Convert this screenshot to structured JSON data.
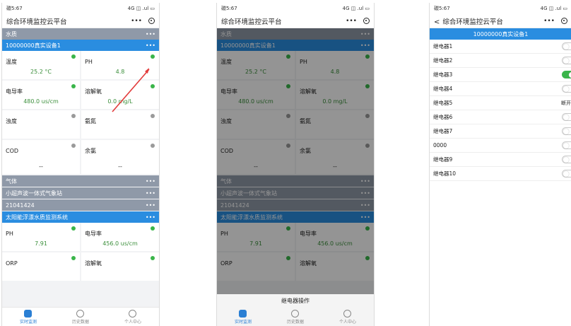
{
  "status_left": "碳5:67",
  "status_right": "4G ◫ .ul ▭",
  "app_title": "综合环境监控云平台",
  "more_label": "•••",
  "colors": {
    "blue": "#2a8de0",
    "gray_header": "#8f99a8",
    "green": "#3ab54a",
    "gray_dot": "#9a9a9a"
  },
  "panel1": {
    "sec_water": "水质",
    "device1": "10000000真实设备1",
    "cards": [
      {
        "label": "温度",
        "value": "25.2 °C",
        "dot": "green"
      },
      {
        "label": "PH",
        "value": "4.8",
        "dot": "green"
      },
      {
        "label": "电导率",
        "value": "480.0 us/cm",
        "dot": "green"
      },
      {
        "label": "溶解氧",
        "value": "0.0 mg/L",
        "dot": "green"
      },
      {
        "label": "浊度",
        "value": "",
        "dot": "gray"
      },
      {
        "label": "氨氮",
        "value": "",
        "dot": "gray"
      },
      {
        "label": "COD",
        "value": "--",
        "dot": "gray"
      },
      {
        "label": "余氯",
        "value": "--",
        "dot": "gray"
      }
    ],
    "sec_gas": "气体",
    "device2": "小超声波一体式气象站",
    "device3": "21041424",
    "device4": "太阳能浮漂水质监测系统",
    "cards2": [
      {
        "label": "PH",
        "value": "7.91",
        "dot": "green"
      },
      {
        "label": "电导率",
        "value": "456.0 us/cm",
        "dot": "green"
      }
    ],
    "cards3": [
      {
        "label": "ORP",
        "dot": "green"
      },
      {
        "label": "溶解氧",
        "dot": "green"
      }
    ]
  },
  "panel2": {
    "sheet_title": "继电器操作"
  },
  "tabs": [
    "实时监测",
    "历史数据",
    "个人中心"
  ],
  "panel3": {
    "back": "<",
    "device": "10000000真实设备1",
    "relays": [
      {
        "name": "继电器1",
        "state": "off"
      },
      {
        "name": "继电器2",
        "state": "off"
      },
      {
        "name": "继电器3",
        "state": "on"
      },
      {
        "name": "继电器4",
        "state": "off"
      },
      {
        "name": "继电器5",
        "state": "text",
        "text": "断开"
      },
      {
        "name": "继电器6",
        "state": "off"
      },
      {
        "name": "继电器7",
        "state": "off"
      },
      {
        "name": "0000",
        "state": "off"
      },
      {
        "name": "继电器9",
        "state": "off"
      },
      {
        "name": "继电器10",
        "state": "off"
      }
    ]
  }
}
